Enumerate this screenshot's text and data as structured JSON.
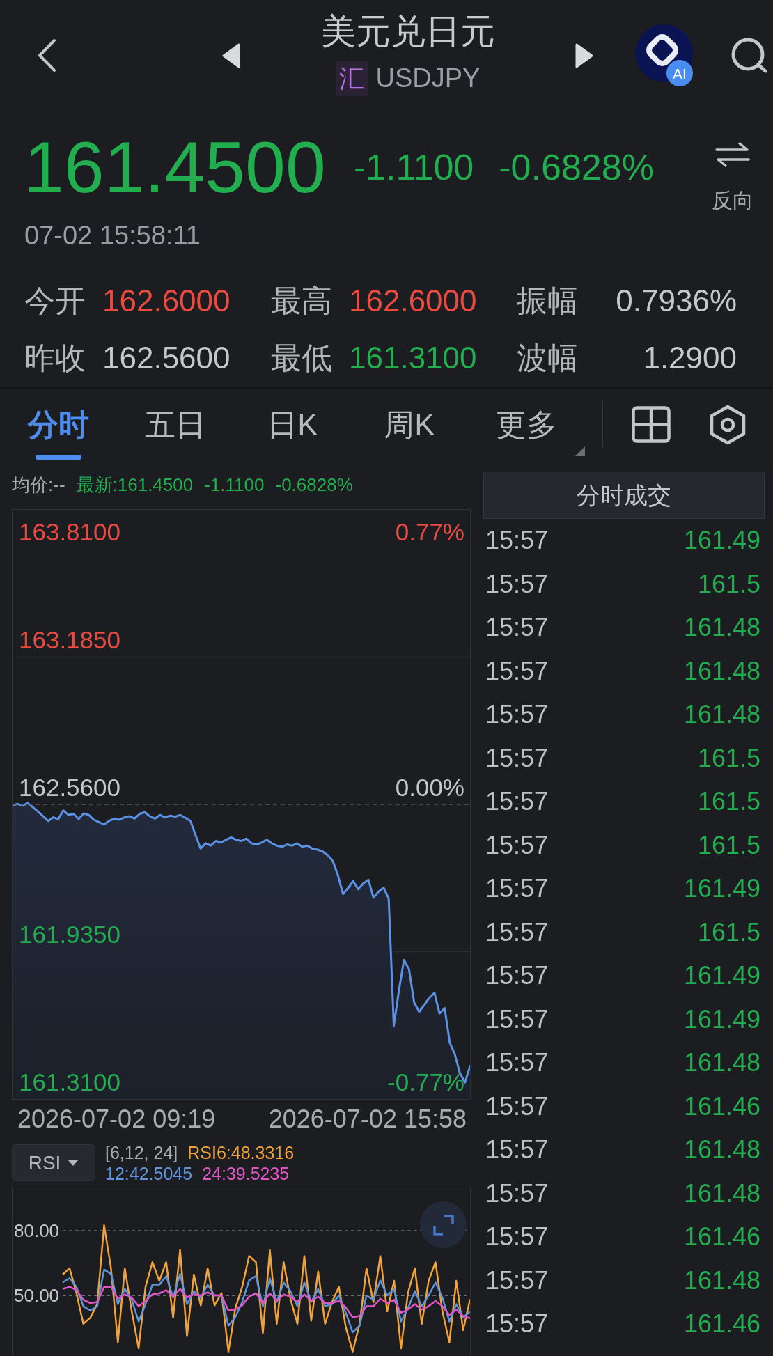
{
  "header": {
    "title": "美元兑日元",
    "market_badge": "汇",
    "symbol": "USDJPY",
    "ai_badge": "AI"
  },
  "quote": {
    "price": "161.4500",
    "change": "-1.1100",
    "change_pct": "-0.6828%",
    "falling": true,
    "time": "07-02 15:58:11",
    "reverse_label": "反向"
  },
  "stats": [
    {
      "label": "今开",
      "value": "162.6000",
      "color": "#ea4a3f"
    },
    {
      "label": "最高",
      "value": "162.6000",
      "color": "#ea4a3f"
    },
    {
      "label": "振幅",
      "value": "0.7936%",
      "color": "#c6c7ca"
    },
    {
      "label": "昨收",
      "value": "162.5600",
      "color": "#c6c7ca"
    },
    {
      "label": "最低",
      "value": "161.3100",
      "color": "#22ad4f"
    },
    {
      "label": "波幅",
      "value": "1.2900",
      "color": "#c6c7ca"
    }
  ],
  "tabs": [
    {
      "label": "分时",
      "selected": true,
      "kind": "plain"
    },
    {
      "label": "五日",
      "selected": false,
      "kind": "plain"
    },
    {
      "label": "日K",
      "selected": false,
      "kind": "plain"
    },
    {
      "label": "周K",
      "selected": false,
      "kind": "plain"
    },
    {
      "label": "更多",
      "selected": false,
      "kind": "dropdown"
    }
  ],
  "intraday": {
    "summary": {
      "avg": "均价:--",
      "latest": "最新:161.4500",
      "change": "-1.1100",
      "change_pct": "-0.6828%"
    },
    "max_label": "163.8100",
    "chart_data": {
      "type": "area",
      "ylim": [
        161.31,
        163.81
      ],
      "yticks": [
        {
          "value": 163.185,
          "label": "163.1850"
        },
        {
          "value": 162.56,
          "label": "162.5600"
        },
        {
          "value": 161.935,
          "label": "161.9350"
        },
        {
          "value": 161.31,
          "label": "161.3100"
        }
      ],
      "series": [
        {
          "color": "#5b92e5",
          "values": [
            162.556,
            162.562,
            162.555,
            162.566,
            162.548,
            162.53,
            162.51,
            162.49,
            162.505,
            162.498,
            162.535,
            162.515,
            162.52,
            162.498,
            162.522,
            162.515,
            162.495,
            162.485,
            162.475,
            162.49,
            162.5,
            162.495,
            162.505,
            162.51,
            162.5,
            162.52,
            162.527,
            162.51,
            162.5,
            162.515,
            162.505,
            162.512,
            162.508,
            162.515,
            162.503,
            162.49,
            162.43,
            162.372,
            162.395,
            162.385,
            162.405,
            162.398,
            162.41,
            162.42,
            162.41,
            162.405,
            162.415,
            162.395,
            162.39,
            162.398,
            162.41,
            162.395,
            162.385,
            162.38,
            162.39,
            162.385,
            162.395,
            162.38,
            162.385,
            162.372,
            162.368,
            162.36,
            162.345,
            162.32,
            162.26,
            162.18,
            162.205,
            162.235,
            162.2,
            162.225,
            162.24,
            162.165,
            162.19,
            162.207,
            162.16,
            161.62,
            161.77,
            161.9,
            161.86,
            161.72,
            161.68,
            161.71,
            161.74,
            161.76,
            161.673,
            161.696,
            161.55,
            161.5,
            161.42,
            161.38,
            161.45
          ]
        }
      ],
      "ref_lines": [
        {
          "axis": "y",
          "value": 162.56
        }
      ],
      "annotations": [
        "0.77%",
        "0.00%",
        "-0.77%"
      ]
    },
    "time_range": [
      "2026-07-02 09:19",
      "2026-07-02 15:58"
    ]
  },
  "indicator": {
    "selector": "RSI",
    "params": "[6,12, 24]",
    "readings": [
      {
        "text": "RSI6:48.3316",
        "color": "#f2a23a"
      },
      {
        "text": "12:42.5045",
        "color": "#5f95dc"
      },
      {
        "text": "24:39.5235",
        "color": "#e055c8"
      }
    ],
    "chart_data": {
      "type": "line",
      "ylim": [
        22,
        100
      ],
      "yticks": [
        {
          "value": 80,
          "label": "80.00"
        },
        {
          "value": 50,
          "label": "50.00"
        }
      ],
      "series": [
        {
          "color": "#f2a23a",
          "values": [
            59.7,
            62.6,
            51.1,
            36.9,
            39.7,
            46,
            82.5,
            62.6,
            28.3,
            62.6,
            42.6,
            25.5,
            54,
            65.4,
            56.8,
            65.4,
            39.7,
            71.1,
            31.2,
            59.7,
            45.4,
            62.6,
            45.4,
            51.1,
            24,
            44,
            54,
            68.3,
            65.4,
            32.6,
            71.1,
            36.9,
            65.4,
            48.3,
            36.9,
            68.3,
            38.3,
            61.1,
            36.9,
            46.9,
            54,
            35.4,
            24,
            36.9,
            62.6,
            46.9,
            68.3,
            42.6,
            56.8,
            25.5,
            51.1,
            62.6,
            36.9,
            56.8,
            65.4,
            42.6,
            28.3,
            56.8,
            34,
            48.3
          ]
        },
        {
          "color": "#5f95dc",
          "values": [
            56,
            58,
            54,
            45,
            43,
            45,
            62,
            60,
            46,
            53,
            48,
            38,
            46,
            55,
            55,
            59,
            49,
            60,
            46,
            52,
            49,
            55,
            50,
            50,
            36,
            40,
            47,
            57,
            59,
            45,
            58,
            47,
            56,
            52,
            45,
            56,
            47,
            53,
            45,
            46,
            50,
            42,
            33,
            36,
            50,
            48,
            57,
            50,
            53,
            38,
            44,
            52,
            45,
            50,
            56,
            49,
            38,
            46,
            40,
            42.5
          ]
        },
        {
          "color": "#e055c8",
          "values": [
            53,
            54,
            52.5,
            48,
            46.5,
            47,
            54,
            54,
            48.5,
            50.5,
            49,
            45,
            47.5,
            50.5,
            51,
            52.5,
            49.5,
            53,
            49,
            50.5,
            50,
            51.5,
            50,
            50,
            43,
            43.5,
            45.5,
            49.5,
            51,
            46.5,
            51,
            47.5,
            50.5,
            49.5,
            47,
            50.5,
            47.5,
            49.5,
            46.5,
            46.5,
            47.5,
            44.5,
            40,
            40.5,
            45,
            45,
            48.5,
            46.5,
            48,
            42,
            43.5,
            46,
            43.5,
            45,
            47.5,
            45,
            41,
            43.5,
            40.5,
            39.5
          ]
        }
      ]
    }
  },
  "trades": {
    "title": "分时成交",
    "rows": [
      {
        "time": "15:57",
        "price": "161.49"
      },
      {
        "time": "15:57",
        "price": "161.5"
      },
      {
        "time": "15:57",
        "price": "161.48"
      },
      {
        "time": "15:57",
        "price": "161.48"
      },
      {
        "time": "15:57",
        "price": "161.48"
      },
      {
        "time": "15:57",
        "price": "161.5"
      },
      {
        "time": "15:57",
        "price": "161.5"
      },
      {
        "time": "15:57",
        "price": "161.5"
      },
      {
        "time": "15:57",
        "price": "161.49"
      },
      {
        "time": "15:57",
        "price": "161.5"
      },
      {
        "time": "15:57",
        "price": "161.49"
      },
      {
        "time": "15:57",
        "price": "161.49"
      },
      {
        "time": "15:57",
        "price": "161.48"
      },
      {
        "time": "15:57",
        "price": "161.46"
      },
      {
        "time": "15:57",
        "price": "161.48"
      },
      {
        "time": "15:57",
        "price": "161.48"
      },
      {
        "time": "15:57",
        "price": "161.46"
      },
      {
        "time": "15:57",
        "price": "161.48"
      },
      {
        "time": "15:57",
        "price": "161.46"
      }
    ]
  }
}
